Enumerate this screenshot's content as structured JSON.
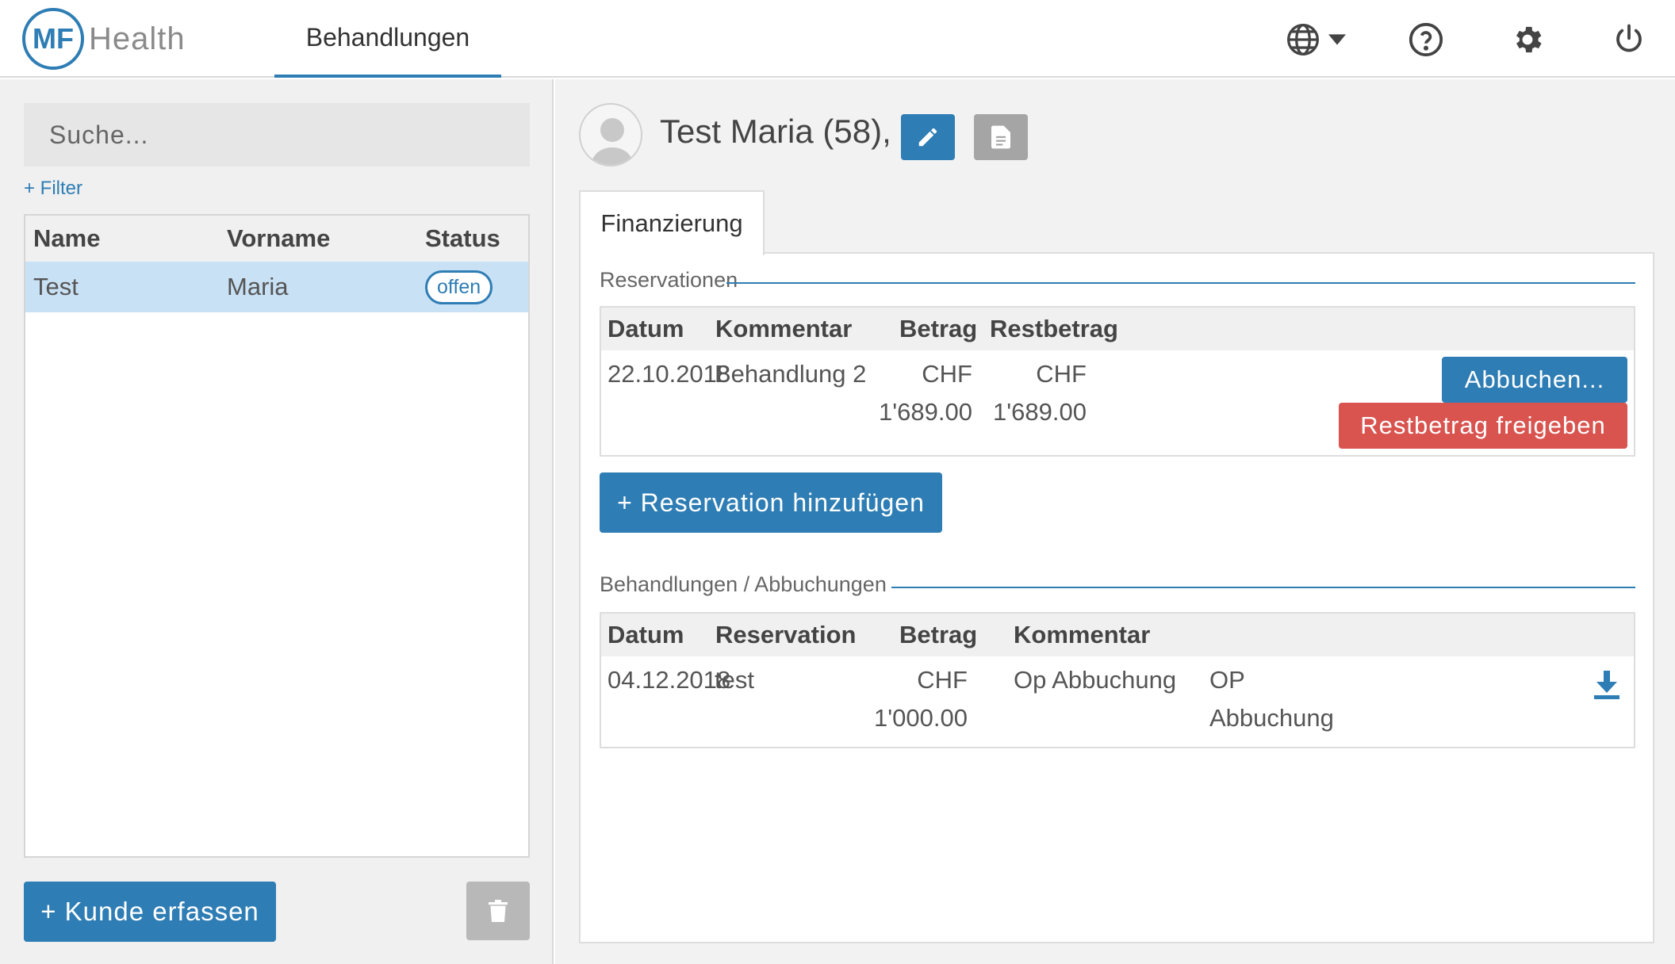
{
  "header": {
    "logo_mark": "MF",
    "logo_text": "Health",
    "nav_tab": "Behandlungen",
    "icons": [
      "globe-icon",
      "help-icon",
      "gear-icon",
      "power-icon"
    ]
  },
  "sidebar": {
    "search_placeholder": "Suche...",
    "filter_link": "+ Filter",
    "table": {
      "columns": [
        "Name",
        "Vorname",
        "Status"
      ],
      "rows": [
        {
          "name": "Test",
          "vorname": "Maria",
          "status": "offen"
        }
      ]
    },
    "add_button": "+ Kunde erfassen"
  },
  "patient": {
    "name": "Test Maria (58),"
  },
  "tab": "Finanzierung",
  "reservationen": {
    "title": "Reservationen",
    "columns": [
      "Datum",
      "Kommentar",
      "Betrag",
      "Restbetrag"
    ],
    "rows": [
      {
        "datum": "22.10.2018",
        "kommentar": "Behandlung 2",
        "betrag_currency": "CHF",
        "betrag_value": "1'689.00",
        "rest_currency": "CHF",
        "rest_value": "1'689.00",
        "abbuchen_label": "Abbuchen...",
        "freigeben_label": "Restbetrag freigeben"
      }
    ],
    "add_button": "+ Reservation hinzufügen"
  },
  "behandlungen": {
    "title": "Behandlungen / Abbuchungen",
    "columns": [
      "Datum",
      "Reservation",
      "Betrag",
      "Kommentar"
    ],
    "rows": [
      {
        "datum": "04.12.2018",
        "reservation": "test",
        "betrag_currency": "CHF",
        "betrag_value": "1'000.00",
        "kommentar": "Op Abbuchung",
        "extra_line1": "OP",
        "extra_line2": "Abbuchung"
      }
    ]
  },
  "colors": {
    "primary": "#2e7db4",
    "danger": "#d9534f",
    "selected_row": "#c9e1f5"
  }
}
